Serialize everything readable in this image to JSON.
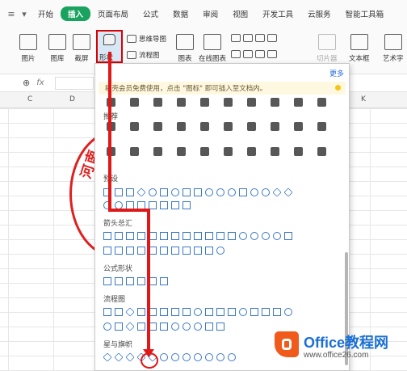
{
  "menubar": {
    "tabs": [
      "开始",
      "插入",
      "页面布局",
      "公式",
      "数据",
      "审阅",
      "视图",
      "开发工具",
      "云服务",
      "智能工具箱"
    ],
    "active_tab": "插入"
  },
  "ribbon": {
    "picture": "图片",
    "gallery": "图库",
    "screenshot": "截屏",
    "shapes": "形状",
    "mindmap": "思维导图",
    "flowchart": "流程图",
    "chart": "图表",
    "online_chart": "在线图表",
    "slicer": "切片器",
    "textbox": "文本框",
    "wordart": "艺术字"
  },
  "formula_bar": {
    "fx": "fx"
  },
  "columns": [
    "C",
    "D",
    "K"
  ],
  "seal": {
    "text": "河南"
  },
  "panel": {
    "more": "更多",
    "notice": "稻壳会员免费使用，点击 \"图标\" 即可插入至文档内。",
    "sections": {
      "recommend": "推荐",
      "preset": "预设",
      "arrows": "箭头总汇",
      "formula": "公式形状",
      "flowchart": "流程图",
      "stars": "星与旗帜"
    }
  },
  "watermark": {
    "brand": "Office教程网",
    "url": "www.office26.com"
  }
}
